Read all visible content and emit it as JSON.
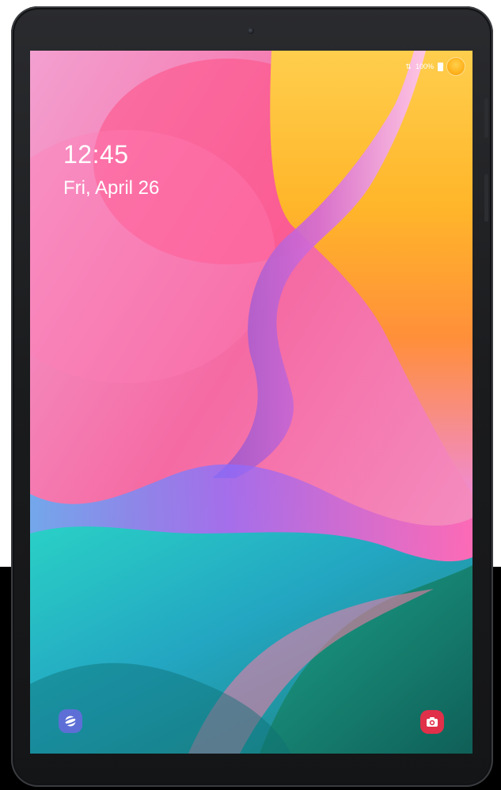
{
  "lock_screen": {
    "time": "12:45",
    "date": "Fri, April 26"
  },
  "status_bar": {
    "battery_text": "100%",
    "icons": [
      "signal-icon",
      "battery-icon",
      "profile-icon"
    ]
  },
  "shortcuts": {
    "left_icon": "internet-icon",
    "right_icon": "camera-icon"
  },
  "colors": {
    "frame": "#1a1b1d",
    "pink": "#f58bb8",
    "magenta": "#f04a8f",
    "yellow": "#ffd24a",
    "orange": "#ff9b1a",
    "teal": "#20c8c8",
    "green": "#1e8f72",
    "internet_shortcut": "#5d6fd6",
    "camera_shortcut": "#e0304a"
  }
}
